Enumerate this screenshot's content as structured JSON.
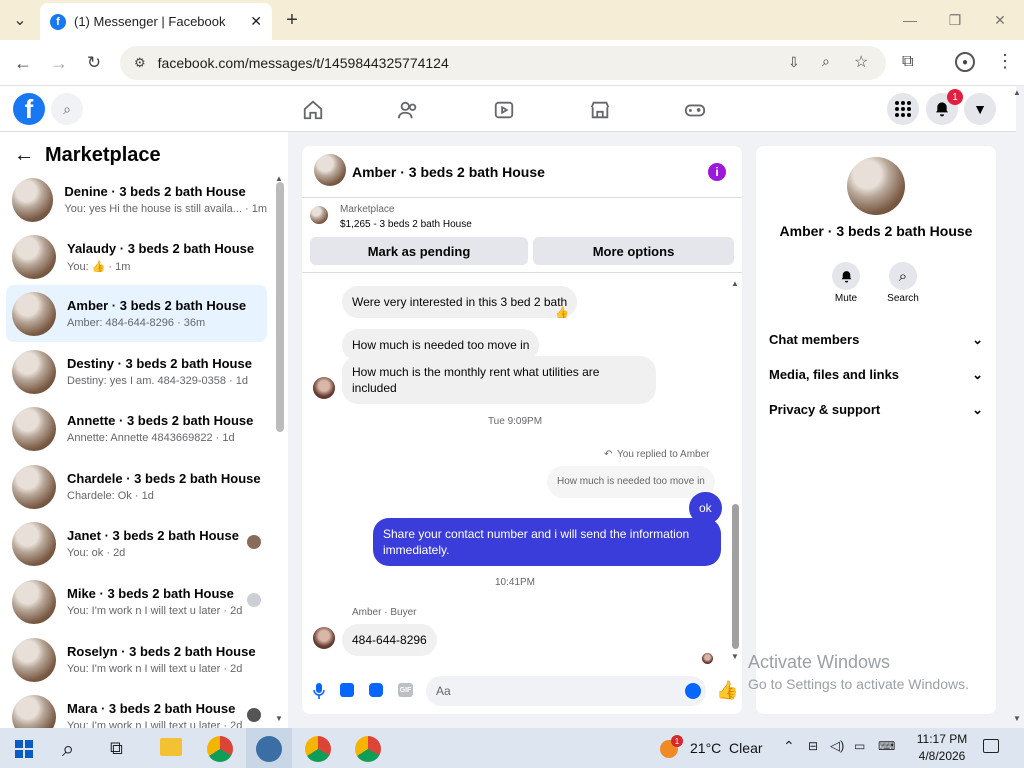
{
  "browser": {
    "tab_title": "(1) Messenger | Facebook",
    "url": "facebook.com/messages/t/1459844325774124"
  },
  "fb": {
    "notification_count": "1"
  },
  "left": {
    "title": "Marketplace",
    "conversations": [
      {
        "name": "Denine · 3 beds 2 bath House",
        "preview": "You: yes Hi the house is still availa... · 1m"
      },
      {
        "name": "Yalaudy · 3 beds 2 bath House",
        "preview": "You: 👍 · 1m"
      },
      {
        "name": "Amber · 3 beds 2 bath House",
        "preview": "Amber: 484-644-8296 · 36m"
      },
      {
        "name": "Destiny · 3 beds 2 bath House",
        "preview": "Destiny: yes I am. 484-329-0358 · 1d"
      },
      {
        "name": "Annette · 3 beds 2 bath House",
        "preview": "Annette: Annette 4843669822 · 1d"
      },
      {
        "name": "Chardele · 3 beds 2 bath House",
        "preview": "Chardele: Ok · 1d"
      },
      {
        "name": "Janet · 3 beds 2 bath House",
        "preview": "You: ok · 2d"
      },
      {
        "name": "Mike · 3 beds 2 bath House",
        "preview": "You: I'm work n I will text u later · 2d"
      },
      {
        "name": "Roselyn · 3 beds 2 bath House",
        "preview": "You: I'm work n I will text u later · 2d"
      },
      {
        "name": "Mara · 3 beds 2 bath House",
        "preview": "You: I'm work n I will text u later · 2d"
      }
    ]
  },
  "chat": {
    "title": "Amber · 3 beds 2 bath House",
    "listing_source": "Marketplace",
    "listing_price": "$1,265 - 3 beds 2 bath House",
    "mark_pending": "Mark as pending",
    "more_options": "More options",
    "messages": {
      "m1": "Were very interested in this 3 bed 2 bath",
      "m1_reaction": "👍",
      "m2": "How much is needed too move in",
      "m3": "How much is the monthly rent what utilities are included",
      "time1": "Tue 9:09PM",
      "replied_to": "You replied to Amber",
      "quoted": "How much is needed too move in",
      "m4": "ok",
      "m5": "Share your contact number and i will send the information immediately.",
      "time2": "10:41PM",
      "sender_label": "Amber · Buyer",
      "m6": "484-644-8296"
    },
    "input_placeholder": "Aa"
  },
  "right": {
    "name": "Amber · 3 beds 2 bath House",
    "mute": "Mute",
    "search": "Search",
    "chat_members": "Chat members",
    "media": "Media, files and links",
    "privacy": "Privacy & support"
  },
  "watermark": {
    "line1": "Activate Windows",
    "line2": "Go to Settings to activate Windows."
  },
  "taskbar": {
    "weather_badge": "1",
    "weather": "21°C  Clear",
    "time": "11:17 PM",
    "date": "4/8/2026"
  }
}
